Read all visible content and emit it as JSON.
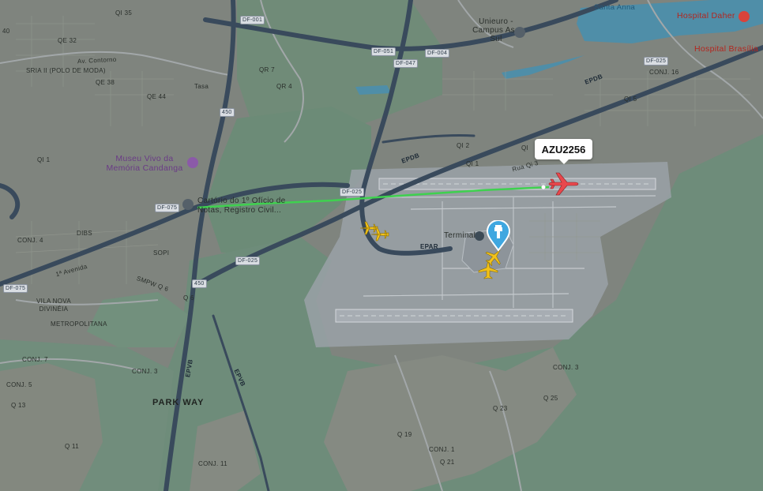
{
  "flight": {
    "callsign": "AZU2256",
    "aircraft_icon": "airplane-icon",
    "aircraft_color": "#e8484d",
    "track_color": "#3fd14f",
    "ground_aircraft_color": "#f2c21a"
  },
  "colors": {
    "urban": "#828781",
    "vegetation": "#6e8f7b",
    "highway": "#394a5c",
    "airport": "#a9b0b6",
    "runway": "#979ea4",
    "water": "#4f8ea8"
  },
  "labels": {
    "museu": "Museu Vivo da Memória Candanga",
    "cartorio": "Cartório do 1º Ofício de Notas, Registro Civil...",
    "terminal": "Terminal",
    "unieuro": "Unieuro - Campus Asa Sul",
    "hospital_daher": "Hospital Daher",
    "hospital_brasilia": "Hospital Brasília",
    "santa_anna": "Santa Anna",
    "park_way": "PARK WAY",
    "qe32": "QE 32",
    "qi35": "QI 35",
    "qe38": "QE 38",
    "qe44": "QE 44",
    "av_contorno": "Av. Contorno",
    "sria": "SRIA II (POLO DE MODA)",
    "qi1": "QI 1",
    "conj4": "CONJ. 4",
    "dibs": "DIBS",
    "sopi": "SOPI",
    "primeira_avenida": "1ª Avenida",
    "vila_nova": "VILA NOVA DIVINÉIA",
    "metropolitana": "METROPOLITANA",
    "conj7": "CONJ. 7",
    "conj5": "CONJ. 5",
    "q13": "Q 13",
    "q11": "Q 11",
    "conj3a": "CONJ. 3",
    "conj11": "CONJ. 11",
    "conj3b": "CONJ. 3",
    "q23": "Q 23",
    "q25": "Q 25",
    "q19": "Q 19",
    "conj1": "CONJ. 1",
    "q21": "Q 21",
    "conj16": "CONJ. 16",
    "qi5": "QI 5",
    "qi2": "QI 2",
    "qi1b": "QI 1",
    "qi": "QI",
    "rua_qi3": "Rua Qi 3",
    "qr7": "QR 7",
    "qr4": "QR 4",
    "tasa": "Tasa",
    "srmwq": "SMPW Q 6",
    "q6": "Q 6",
    "df001": "DF-001",
    "df051": "DF-051",
    "df047": "DF-047",
    "df004": "DF-004",
    "df025a": "DF-025",
    "df025b": "DF-025",
    "df075a": "DF-075",
    "df075b": "DF-075",
    "df025c": "DF-025",
    "eppr": "EPDB",
    "epdb": "EPDB",
    "epar": "EPAR",
    "epvb": "EPVB",
    "epvb2": "EPVB",
    "r450": "450",
    "r450b": "450",
    "qi45": "QI 45",
    "r40": "40"
  }
}
